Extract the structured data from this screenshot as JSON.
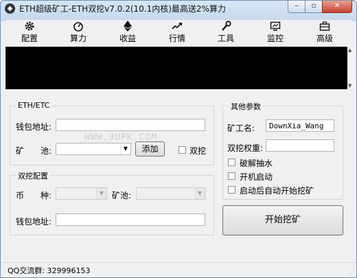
{
  "window": {
    "title": "ETH超级矿工-ETH双挖v7.0.2(10.1内核)最高送2%算力",
    "app_icon": "eth-logo-icon",
    "controls": {
      "minimize": "‒",
      "maximize": "▫",
      "close": "✕"
    }
  },
  "toolbar": {
    "items": [
      {
        "label": "配置",
        "icon": "gear-icon",
        "glyph": "⚙"
      },
      {
        "label": "算力",
        "icon": "gauge-icon",
        "glyph": "◔"
      },
      {
        "label": "收益",
        "icon": "ethereum-icon",
        "glyph": "◆"
      },
      {
        "label": "行情",
        "icon": "trend-icon",
        "glyph": "↗"
      },
      {
        "label": "工具",
        "icon": "wrench-icon",
        "glyph": "🔧"
      },
      {
        "label": "监控",
        "icon": "monitor-icon",
        "glyph": "▭"
      },
      {
        "label": "高级",
        "icon": "toolbox-icon",
        "glyph": "▣"
      }
    ]
  },
  "eth_group": {
    "title": "ETH/ETC",
    "wallet_label": "钱包地址:",
    "wallet_value": "",
    "pool_label_1": "矿",
    "pool_label_2": "池:",
    "pool_value": "",
    "add_button": "添加",
    "dual_label": "双挖",
    "dual_checked": false
  },
  "dual_group": {
    "title": "双挖配置",
    "coin_label_1": "币",
    "coin_label_2": "种:",
    "pool_label": "矿池:",
    "wallet_label": "钱包地址:",
    "wallet_value": ""
  },
  "other_group": {
    "title": "其他参数",
    "worker_label": "矿工名:",
    "worker_value": "DownXia_Wang",
    "weight_label": "双挖权重:",
    "weight_value": "",
    "options": [
      {
        "label": "破解抽水",
        "checked": false
      },
      {
        "label": "开机启动",
        "checked": false
      },
      {
        "label": "启动后自动开始挖矿",
        "checked": false
      }
    ]
  },
  "start_button": "开始挖矿",
  "watermark": "WWW.9UPK.COM",
  "status": {
    "text": "QQ交流群: 329996153"
  }
}
